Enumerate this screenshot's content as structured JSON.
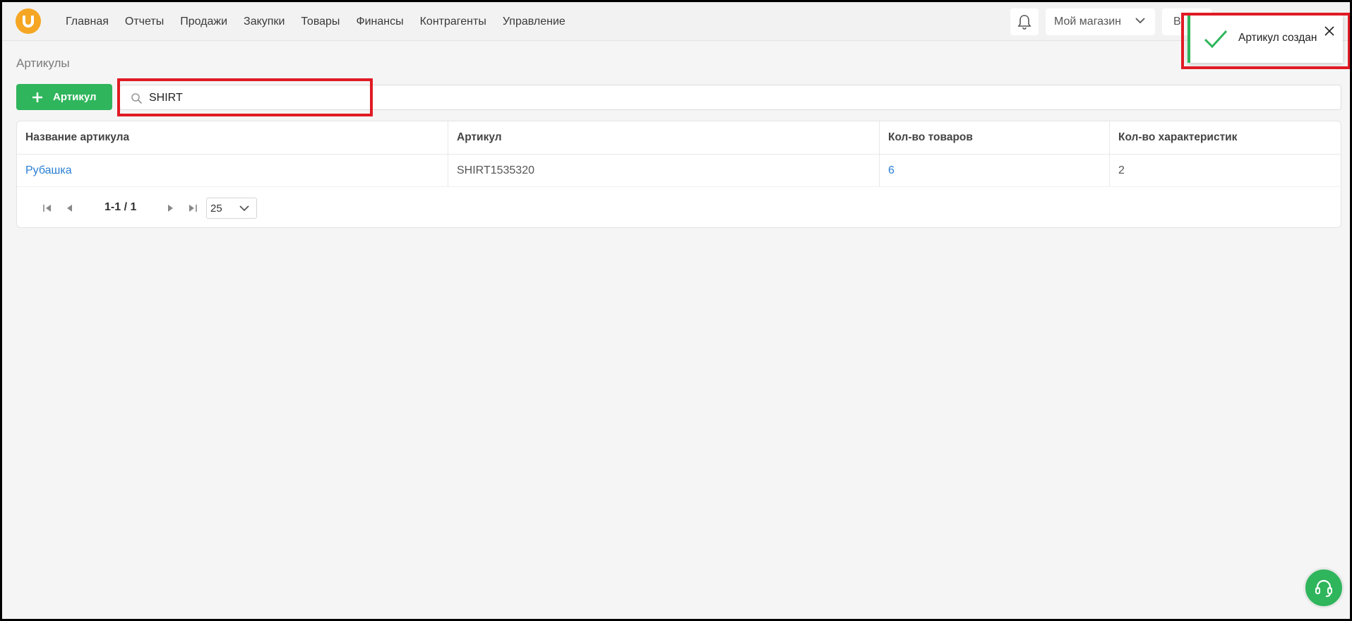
{
  "nav": {
    "items": [
      "Главная",
      "Отчеты",
      "Продажи",
      "Закупки",
      "Товары",
      "Финансы",
      "Контрагенты",
      "Управление"
    ]
  },
  "header": {
    "store_label": "Мой магазин",
    "partial_button_label": "В"
  },
  "page": {
    "title": "Артикулы",
    "add_button_label": "Артикул"
  },
  "search": {
    "value": "SHIRT"
  },
  "table": {
    "headers": [
      "Название артикула",
      "Артикул",
      "Кол-во товаров",
      "Кол-во характеристик"
    ],
    "rows": [
      {
        "name": "Рубашка",
        "article": "SHIRT1535320",
        "products": "6",
        "characteristics": "2"
      }
    ]
  },
  "pagination": {
    "range": "1-1 / 1",
    "page_size": "25"
  },
  "toast": {
    "message": "Артикул создан"
  },
  "colors": {
    "accent_green": "#2fb55b",
    "logo_orange": "#f5a623",
    "link_blue": "#2a7fd4",
    "highlight_red": "#e01b24"
  }
}
